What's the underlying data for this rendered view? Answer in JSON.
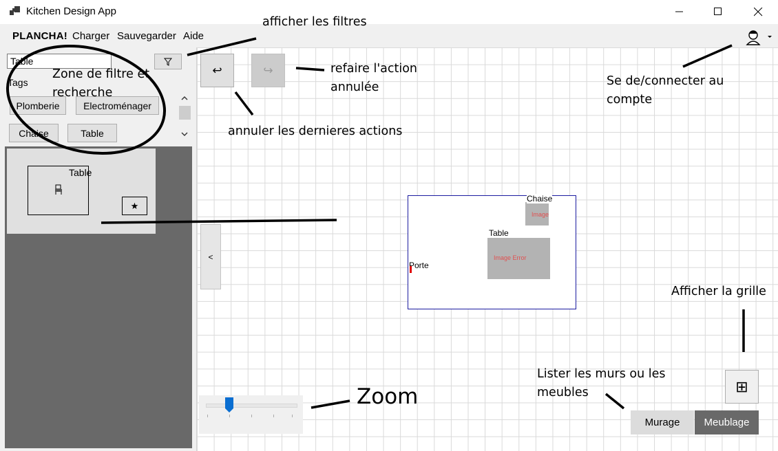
{
  "window": {
    "title": "Kitchen Design App",
    "controls": [
      "minimize-icon",
      "maximize-icon",
      "close-icon"
    ]
  },
  "menu": {
    "brand": "PLANCHA!",
    "items": [
      "Charger",
      "Sauvegarder",
      "Aide"
    ],
    "user_icon": "user-account-icon"
  },
  "left_panel": {
    "search_value": "Table",
    "filter_icon": "funnel-icon",
    "tags_label": "Tags",
    "tags": [
      "Plomberie",
      "Electroménager",
      "Chaise",
      "Table"
    ],
    "catalog": [
      {
        "title": "Table",
        "icon": "furniture-icon",
        "favorite_icon": "star-icon",
        "favorite_symbol": "★"
      }
    ]
  },
  "toolbar": {
    "undo_symbol": "↩",
    "redo_symbol": "↪",
    "collapse_symbol": "<"
  },
  "plan": {
    "items": [
      {
        "label": "Chaise",
        "image_text": "Image Error"
      },
      {
        "label": "Table",
        "image_text": "Image Error"
      }
    ],
    "door_label": "Porte"
  },
  "bottom": {
    "grid_icon": "grid-icon",
    "grid_symbol": "⊞",
    "tabs": [
      "Murage",
      "Meublage"
    ],
    "active_tab": "Meublage"
  },
  "colors": {
    "room_border": "#1a1aa0",
    "error_text": "#e05050",
    "door": "#e00000",
    "slider_thumb": "#0a6ed1",
    "active_tab": "#696969"
  },
  "annotations": {
    "show_filters": "afficher les filtres",
    "filter_zone_1": "Zone de filtre et",
    "filter_zone_2": "recherche",
    "redo_1": "refaire l'action",
    "redo_2": "annulée",
    "undo": "annuler les dernieres actions",
    "account_1": "Se de/connecter au",
    "account_2": "compte",
    "show_grid": "Afficher la grille",
    "list_1": "Lister les murs ou les",
    "list_2": "meubles",
    "zoom": "Zoom"
  }
}
